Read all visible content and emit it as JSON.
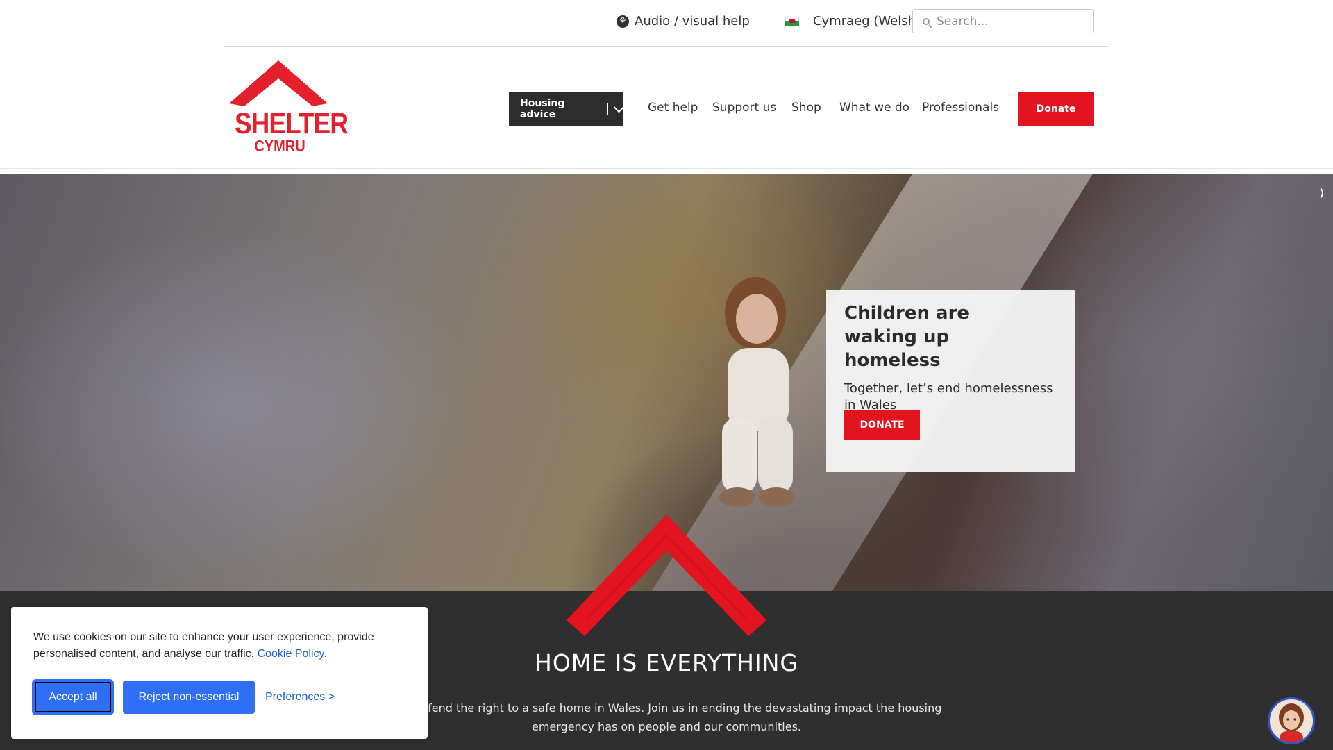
{
  "utility": {
    "audio_help": "Audio / visual help",
    "language": "Cymraeg (Welsh)",
    "search_placeholder": "Search..."
  },
  "header": {
    "logo_name": "SHELTER",
    "logo_sub": "CYMRU",
    "housing_advice": "Housing advice",
    "nav": [
      "Get help",
      "Support us",
      "Shop",
      "What we do",
      "Professionals"
    ],
    "donate": "Donate"
  },
  "hero": {
    "title": "Children are waking up homeless",
    "text": "Together, let’s end homelessness in Wales",
    "donate": "DONATE"
  },
  "band": {
    "title": "HOME IS EVERYTHING",
    "text_line1": "t to defend the right to a safe home in Wales. Join us in ending the devastating impact the housing",
    "text_line2": "emergency has on people and our communities."
  },
  "cookie": {
    "message": "We use cookies on our site to enhance your user experience, provide personalised content, and analyse our traffic. ",
    "policy_link": "Cookie Policy.",
    "accept": "Accept all",
    "reject": "Reject non-essential",
    "preferences": "Preferences",
    "preferences_arrow": " >"
  },
  "colors": {
    "brand_red": "#e3131f",
    "dark_button": "#2d2d2d",
    "cookie_blue": "#2f6ff5",
    "band_bg": "#2f2f2f"
  },
  "icons": [
    "accessibility-icon",
    "welsh-flag-icon",
    "search-icon",
    "chevron-down-icon",
    "loading-spinner-icon",
    "chat-avatar-icon"
  ]
}
